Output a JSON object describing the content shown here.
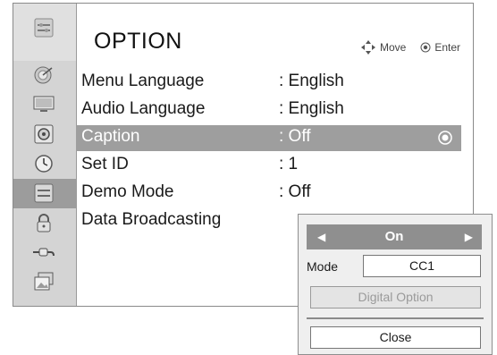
{
  "header": {
    "title": "OPTION",
    "hints": {
      "move_label": "Move",
      "enter_label": "Enter"
    }
  },
  "sidebar": {
    "top_icon": "option-header-icon",
    "items": [
      {
        "icon": "satellite-dish-icon",
        "name": "setup"
      },
      {
        "icon": "monitor-icon",
        "name": "picture"
      },
      {
        "icon": "speaker-icon",
        "name": "audio"
      },
      {
        "icon": "clock-icon",
        "name": "time"
      },
      {
        "icon": "option-icon",
        "name": "option",
        "active": true
      },
      {
        "icon": "lock-icon",
        "name": "lock"
      },
      {
        "icon": "input-plug-icon",
        "name": "input"
      },
      {
        "icon": "photo-album-icon",
        "name": "usb"
      }
    ]
  },
  "menu": {
    "items": [
      {
        "label": "Menu Language",
        "value": ": English"
      },
      {
        "label": "Audio Language",
        "value": ": English"
      },
      {
        "label": "Caption",
        "value": ": Off",
        "selected": true
      },
      {
        "label": "Set ID",
        "value": ": 1"
      },
      {
        "label": "Demo Mode",
        "value": ": Off"
      },
      {
        "label": "Data Broadcasting",
        "value": ""
      }
    ]
  },
  "popup": {
    "selector_value": "On",
    "mode_label": "Mode",
    "mode_value": "CC1",
    "digital_option_label": "Digital Option",
    "close_label": "Close"
  },
  "colors": {
    "selected_row": "#9e9e9e",
    "sidebar_bg": "#d4d4d4",
    "sidebar_active": "#9c9c9c",
    "popup_bg": "#efefef",
    "selector_bg": "#8f8f8f"
  }
}
